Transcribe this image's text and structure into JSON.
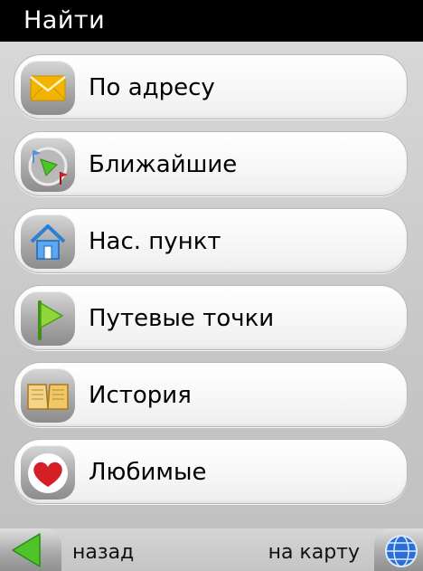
{
  "header": {
    "title": "Найти"
  },
  "menu": {
    "items": [
      {
        "id": "address",
        "label": "По адресу",
        "icon": "envelope-icon"
      },
      {
        "id": "nearest",
        "label": "Ближайшие",
        "icon": "compass-icon"
      },
      {
        "id": "settlement",
        "label": "Нас. пункт",
        "icon": "house-icon"
      },
      {
        "id": "waypoints",
        "label": "Путевые точки",
        "icon": "flag-icon"
      },
      {
        "id": "history",
        "label": "История",
        "icon": "open-book-icon"
      },
      {
        "id": "favorites",
        "label": "Любимые",
        "icon": "heart-icon"
      }
    ]
  },
  "footer": {
    "back_label": "назад",
    "map_label": "на карту",
    "back_icon": "back-arrow-icon",
    "map_icon": "globe-icon"
  },
  "colors": {
    "title_bar": "#000000",
    "background": "#c8c9c8",
    "button": "#f8f8f8",
    "envelope": "#f2b400",
    "arrow_green": "#4fc32a",
    "globe_blue": "#2a6fd6",
    "heart_red": "#d41f27"
  }
}
